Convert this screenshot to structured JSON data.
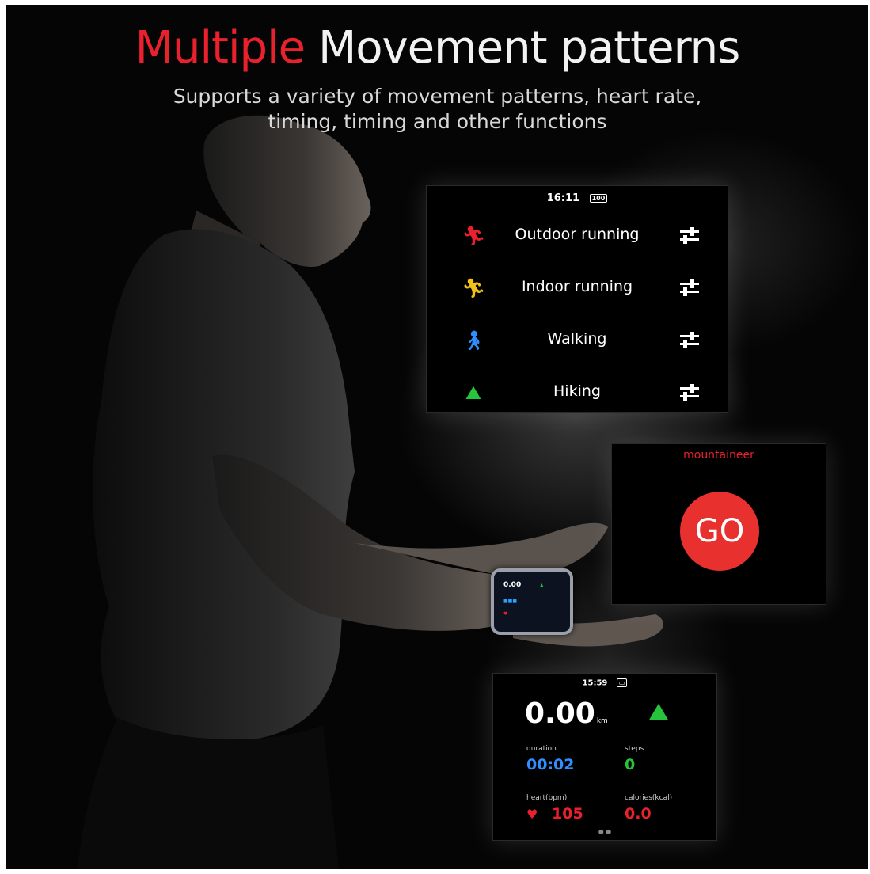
{
  "headline": {
    "highlight": "Multiple",
    "rest": "Movement patterns",
    "subtitle_line1": "Supports a variety of movement patterns, heart rate,",
    "subtitle_line2": "timing, timing and other functions"
  },
  "sport_list_screen": {
    "time": "16:11",
    "battery": "100",
    "items": [
      {
        "label": "Outdoor running",
        "icon": "running-icon",
        "icon_color": "#e8212c"
      },
      {
        "label": "Indoor running",
        "icon": "treadmill-icon",
        "icon_color": "#f2c21b"
      },
      {
        "label": "Walking",
        "icon": "walking-icon",
        "icon_color": "#2f8fff"
      },
      {
        "label": "Hiking",
        "icon": "hiking-icon",
        "icon_color": "#25c43a"
      }
    ]
  },
  "start_screen": {
    "mode": "mountaineer",
    "button": "GO",
    "button_color": "#e8312e"
  },
  "workout_screen": {
    "time": "15:59",
    "distance": "0.00",
    "distance_unit": "km",
    "duration_label": "duration",
    "duration_value": "00:02",
    "steps_label": "steps",
    "steps_value": "0",
    "heart_label": "heart(bpm)",
    "heart_value": "105",
    "calories_label": "calories(kcal)",
    "calories_value": "0.0",
    "colors": {
      "duration": "#2f8fff",
      "steps": "#25c43a",
      "heart": "#e8212c",
      "calories": "#e8212c"
    }
  },
  "watch_display": {
    "value": "0.00"
  }
}
